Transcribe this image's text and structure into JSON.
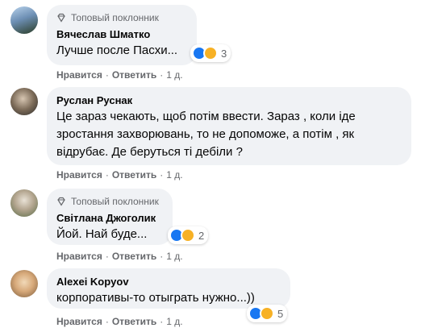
{
  "comments": [
    {
      "badge": "Топовый поклонник",
      "author": "Вячеслав Шматко",
      "text": "Лучше после Пасхи...",
      "reaction_count": "3",
      "actions": {
        "like": "Нравится",
        "reply": "Ответить",
        "time": "1 д."
      }
    },
    {
      "badge": "",
      "author": "Руслан Руснак",
      "text": "Це зараз чекають, щоб потім ввести. Зараз , коли іде зростання захворювань, то не допоможе, а потім , як відрубає. Де беруться ті дебіли ?",
      "reaction_count": "",
      "actions": {
        "like": "Нравится",
        "reply": "Ответить",
        "time": "1 д."
      }
    },
    {
      "badge": "Топовый поклонник",
      "author": "Світлана Джоголик",
      "text": "Йой. Най буде...",
      "reaction_count": "2",
      "actions": {
        "like": "Нравится",
        "reply": "Ответить",
        "time": "1 д."
      }
    },
    {
      "badge": "",
      "author": "Alexei Kopyov",
      "text": "корпоративы-то отыграть нужно...))",
      "reaction_count": "5",
      "actions": {
        "like": "Нравится",
        "reply": "Ответить",
        "time": "1 д."
      }
    }
  ],
  "colors": {
    "bubble": "#f0f2f5",
    "meta_text": "#65676b",
    "like_blue": "#1877f2",
    "haha_yellow": "#f7b125"
  }
}
